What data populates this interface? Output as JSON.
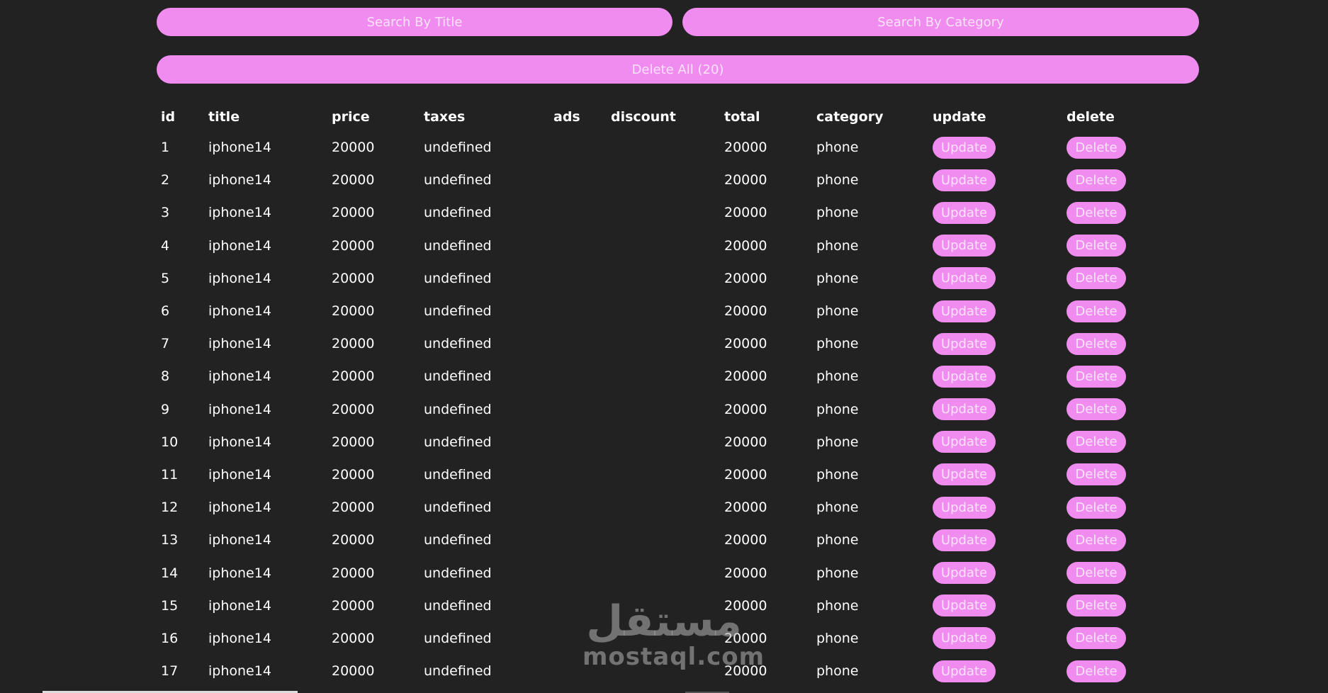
{
  "controls": {
    "search_title_label": "Search By Title",
    "search_category_label": "Search By Category",
    "delete_all_label": "Delete All (20)"
  },
  "table": {
    "headers": [
      "id",
      "title",
      "price",
      "taxes",
      "ads",
      "discount",
      "total",
      "category",
      "update",
      "delete"
    ],
    "update_label": "Update",
    "delete_label": "Delete",
    "rows": [
      {
        "id": "1",
        "title": "iphone14",
        "price": "20000",
        "taxes": "undefined",
        "ads": "",
        "discount": "",
        "total": "20000",
        "category": "phone"
      },
      {
        "id": "2",
        "title": "iphone14",
        "price": "20000",
        "taxes": "undefined",
        "ads": "",
        "discount": "",
        "total": "20000",
        "category": "phone"
      },
      {
        "id": "3",
        "title": "iphone14",
        "price": "20000",
        "taxes": "undefined",
        "ads": "",
        "discount": "",
        "total": "20000",
        "category": "phone"
      },
      {
        "id": "4",
        "title": "iphone14",
        "price": "20000",
        "taxes": "undefined",
        "ads": "",
        "discount": "",
        "total": "20000",
        "category": "phone"
      },
      {
        "id": "5",
        "title": "iphone14",
        "price": "20000",
        "taxes": "undefined",
        "ads": "",
        "discount": "",
        "total": "20000",
        "category": "phone"
      },
      {
        "id": "6",
        "title": "iphone14",
        "price": "20000",
        "taxes": "undefined",
        "ads": "",
        "discount": "",
        "total": "20000",
        "category": "phone"
      },
      {
        "id": "7",
        "title": "iphone14",
        "price": "20000",
        "taxes": "undefined",
        "ads": "",
        "discount": "",
        "total": "20000",
        "category": "phone"
      },
      {
        "id": "8",
        "title": "iphone14",
        "price": "20000",
        "taxes": "undefined",
        "ads": "",
        "discount": "",
        "total": "20000",
        "category": "phone"
      },
      {
        "id": "9",
        "title": "iphone14",
        "price": "20000",
        "taxes": "undefined",
        "ads": "",
        "discount": "",
        "total": "20000",
        "category": "phone"
      },
      {
        "id": "10",
        "title": "iphone14",
        "price": "20000",
        "taxes": "undefined",
        "ads": "",
        "discount": "",
        "total": "20000",
        "category": "phone"
      },
      {
        "id": "11",
        "title": "iphone14",
        "price": "20000",
        "taxes": "undefined",
        "ads": "",
        "discount": "",
        "total": "20000",
        "category": "phone"
      },
      {
        "id": "12",
        "title": "iphone14",
        "price": "20000",
        "taxes": "undefined",
        "ads": "",
        "discount": "",
        "total": "20000",
        "category": "phone"
      },
      {
        "id": "13",
        "title": "iphone14",
        "price": "20000",
        "taxes": "undefined",
        "ads": "",
        "discount": "",
        "total": "20000",
        "category": "phone"
      },
      {
        "id": "14",
        "title": "iphone14",
        "price": "20000",
        "taxes": "undefined",
        "ads": "",
        "discount": "",
        "total": "20000",
        "category": "phone"
      },
      {
        "id": "15",
        "title": "iphone14",
        "price": "20000",
        "taxes": "undefined",
        "ads": "",
        "discount": "",
        "total": "20000",
        "category": "phone"
      },
      {
        "id": "16",
        "title": "iphone14",
        "price": "20000",
        "taxes": "undefined",
        "ads": "",
        "discount": "",
        "total": "20000",
        "category": "phone"
      },
      {
        "id": "17",
        "title": "iphone14",
        "price": "20000",
        "taxes": "undefined",
        "ads": "",
        "discount": "",
        "total": "20000",
        "category": "phone"
      }
    ]
  },
  "watermark": {
    "logo_text": "مستقل",
    "site_text": "mostaql.com"
  },
  "colors": {
    "background": "#222222",
    "accent": "#f08cf0",
    "button_text": "#fbe4fb",
    "text": "#ffffff"
  }
}
